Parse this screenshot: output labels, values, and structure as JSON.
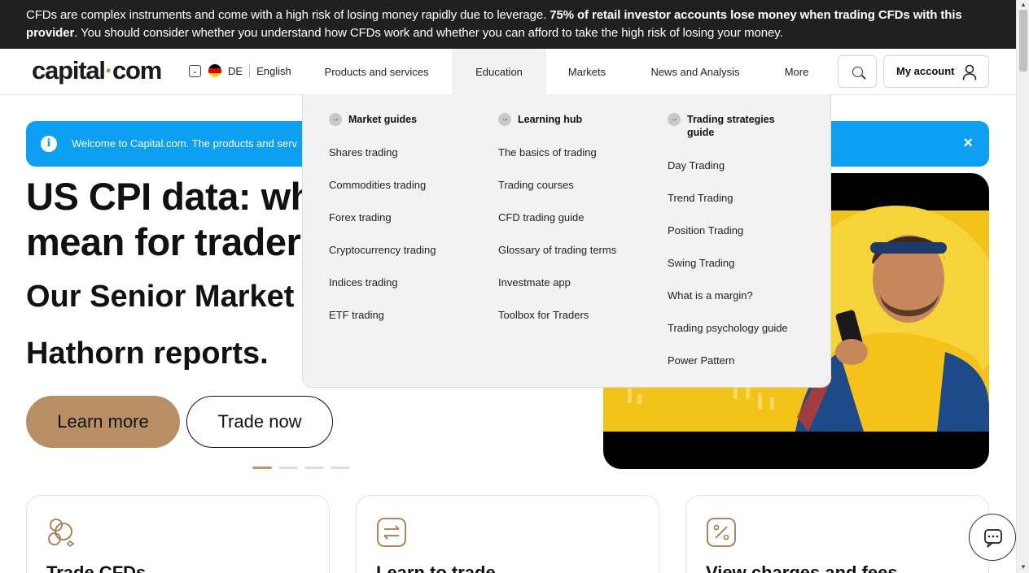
{
  "risk_banner": {
    "text_1": "CFDs are complex instruments and come with a high risk of losing money rapidly due to leverage. ",
    "text_bold": "75% of retail investor accounts lose money when trading CFDs with this provider",
    "text_2": ". You should consider whether you understand how CFDs work and whether you can afford to take the high risk of losing your money."
  },
  "header": {
    "logo_main": "capital",
    "logo_dot": "·",
    "logo_end": "com",
    "country": "DE",
    "language": "English",
    "nav": [
      "Products and services",
      "Education",
      "Markets",
      "News and Analysis",
      "More"
    ],
    "active_nav": "Education",
    "account_label": "My account"
  },
  "notice": {
    "text": "Welcome to Capital.com. The products and serv",
    "info_icon": "i",
    "close_icon": "×"
  },
  "hero": {
    "headline_line1": "US CPI data: wh",
    "headline_line2": "mean for trader",
    "subline_1": "Our Senior Market",
    "subline_2": "Hathorn reports.",
    "learn_more": "Learn more",
    "trade_now": "Trade now",
    "slides": 4,
    "active_slide": 1
  },
  "dropdown": {
    "columns": [
      {
        "heading": "Market guides",
        "links": [
          "Shares trading",
          "Commodities trading",
          "Forex trading",
          "Cryptocurrency trading",
          "Indices trading",
          "ETF trading"
        ]
      },
      {
        "heading": "Learning hub",
        "links": [
          "The basics of trading",
          "Trading courses",
          "CFD trading guide",
          "Glossary of trading terms",
          "Investmate app",
          "Toolbox for Traders"
        ]
      },
      {
        "heading": "Trading strategies guide",
        "links": [
          "Day Trading",
          "Trend Trading",
          "Position Trading",
          "Swing Trading",
          "What is a margin?",
          "Trading psychology guide",
          "Power Pattern"
        ]
      }
    ]
  },
  "cards": [
    {
      "title": "Trade CFDs",
      "icon": "circles-icon"
    },
    {
      "title": "Learn to trade",
      "icon": "exchange-arrows-icon"
    },
    {
      "title": "View charges and fees",
      "icon": "percent-icon"
    }
  ],
  "colors": {
    "accent": "#b88e64",
    "notice_blue": "#0d9ff2",
    "banner_dark": "#202020"
  }
}
